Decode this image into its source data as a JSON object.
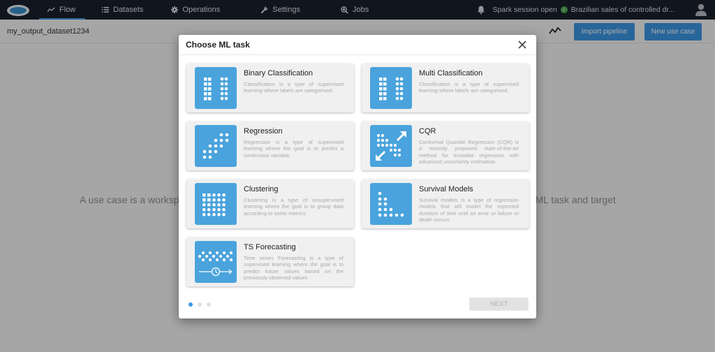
{
  "topbar": {
    "logo": "app-logo",
    "nav": [
      {
        "label": "Flow",
        "icon": "trend-line-icon",
        "active": true
      },
      {
        "label": "Datasets",
        "icon": "list-icon",
        "active": false
      },
      {
        "label": "Operations",
        "icon": "gear-icon",
        "active": false
      },
      {
        "label": "Settings",
        "icon": "wrench-icon",
        "active": false
      },
      {
        "label": "Jobs",
        "icon": "search-globe-icon",
        "active": false
      }
    ],
    "notification_icon": "bell-icon",
    "spark_status": "Spark session open",
    "status_icon": "check-circle-icon",
    "project_name": "Brazilian sales of controlled dr...",
    "user_icon": "user-icon"
  },
  "subheader": {
    "dataset_name": "my_output_dataset1234",
    "import_pipeline_label": "Import pipeline",
    "new_use_case_label": "New use case"
  },
  "background": {
    "text_left": "A use case is a worksp",
    "text_right": "ven ML task and target"
  },
  "modal": {
    "title": "Choose ML task",
    "close_icon": "close-icon",
    "tasks": [
      {
        "title": "Binary Classification",
        "description": "Classification is a type of supervised learning where labels are categorised.",
        "icon": "binary-classification-icon"
      },
      {
        "title": "Multi Classification",
        "description": "Classification is a type of supervised learning where labels are categorised.",
        "icon": "multi-classification-icon"
      },
      {
        "title": "Regression",
        "description": "Regression is a type of supervised learning where the goal is to predict a continuous variable.",
        "icon": "regression-icon"
      },
      {
        "title": "CQR",
        "description": "Conformal Quantile Regression (CQR) is a recently proposed state-of-the-art method for trustable regression with advanced uncertainty estimation.",
        "icon": "cqr-icon"
      },
      {
        "title": "Clustering",
        "description": "Clustering is a type of unsupervised learning where the goal is to group data according to some metrics.",
        "icon": "clustering-icon"
      },
      {
        "title": "Survival Models",
        "description": "Survival models is a type of regression models that will model the expected duration of time until an error or failure or death occurs.",
        "icon": "survival-models-icon"
      },
      {
        "title": "TS Forecasting",
        "description": "Time series Forecasting is a type of supervised learning where the goal is to predict future values based on the previously observed values",
        "icon": "ts-forecasting-icon"
      }
    ],
    "pagination": {
      "current": 1,
      "total": 3
    },
    "next_label": "NEXT"
  },
  "colors": {
    "accent": "#3b97e3",
    "topbar": "#1a1f2b",
    "icon_tile": "#4aa3dc",
    "success": "#4caf50"
  }
}
